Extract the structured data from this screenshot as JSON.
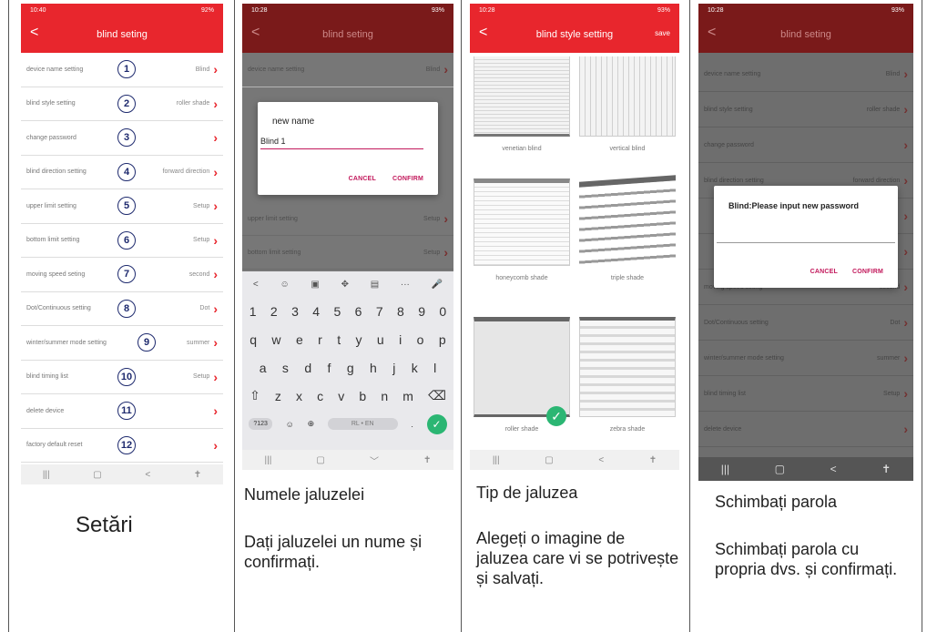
{
  "status": {
    "left": "10:40",
    "right": "92%",
    "left2": "10:28",
    "right2": "93%"
  },
  "screen1": {
    "title": "blind seting",
    "back": "<",
    "rows": [
      {
        "num": "1",
        "label": "device name setting",
        "value": "Blind"
      },
      {
        "num": "2",
        "label": "blind style setting",
        "value": "roller shade"
      },
      {
        "num": "3",
        "label": "change password",
        "value": ""
      },
      {
        "num": "4",
        "label": "blind direction setting",
        "value": "forward direction"
      },
      {
        "num": "5",
        "label": "upper limit setting",
        "value": "Setup"
      },
      {
        "num": "6",
        "label": "bottom limit setting",
        "value": "Setup"
      },
      {
        "num": "7",
        "label": "moving speed seting",
        "value": "second"
      },
      {
        "num": "8",
        "label": "Dot/Continuous setting",
        "value": "Dot"
      },
      {
        "num": "9",
        "label": "winter/summer mode setting",
        "value": "summer"
      },
      {
        "num": "10",
        "label": "blind timing list",
        "value": "Setup"
      },
      {
        "num": "11",
        "label": "delete device",
        "value": ""
      },
      {
        "num": "12",
        "label": "factory default reset",
        "value": ""
      }
    ],
    "nav": [
      "|||",
      "▢",
      "<",
      "✝"
    ]
  },
  "screen2": {
    "title": "blind seting",
    "bg_rows": [
      {
        "label": "device name setting",
        "value": "Blind"
      },
      {
        "label": "upper limit setting",
        "value": "Setup"
      },
      {
        "label": "bottom limit setting",
        "value": "Setup"
      }
    ],
    "dialog": {
      "title": "new name",
      "value": "Blind 1",
      "cancel": "CANCEL",
      "confirm": "CONFIRM"
    },
    "keyboard": {
      "tools": [
        "<",
        "☺",
        "▣",
        "✥",
        "▤",
        "···",
        "🎤"
      ],
      "row1": [
        "1",
        "2",
        "3",
        "4",
        "5",
        "6",
        "7",
        "8",
        "9",
        "0"
      ],
      "row2": [
        "q",
        "w",
        "e",
        "r",
        "t",
        "y",
        "u",
        "i",
        "o",
        "p"
      ],
      "row3": [
        "a",
        "s",
        "d",
        "f",
        "g",
        "h",
        "j",
        "k",
        "l"
      ],
      "row4": [
        "⇧",
        "z",
        "x",
        "c",
        "v",
        "b",
        "n",
        "m",
        "⌫"
      ],
      "row5": [
        "?123",
        "☺",
        "⊕",
        "RL • EN",
        ".",
        "✓"
      ]
    },
    "nav": [
      "|||",
      "▢",
      "﹀",
      "✝"
    ]
  },
  "screen3": {
    "title": "blind style setting",
    "save": "save",
    "blinds": [
      {
        "label": "venetian blind"
      },
      {
        "label": "vertical blind"
      },
      {
        "label": "honeycomb shade"
      },
      {
        "label": "triple shade"
      },
      {
        "label": "roller shade"
      },
      {
        "label": "zebra shade"
      }
    ],
    "nav": [
      "|||",
      "▢",
      "<",
      "✝"
    ]
  },
  "screen4": {
    "title": "blind seting",
    "bg_rows": [
      {
        "label": "device name setting",
        "value": "Blind"
      },
      {
        "label": "blind style setting",
        "value": "roller shade"
      },
      {
        "label": "change password",
        "value": ""
      },
      {
        "label": "blind direction setting",
        "value": "forward direction"
      },
      {
        "label": "",
        "value": ""
      },
      {
        "label": "",
        "value": ""
      },
      {
        "label": "moving speed seting",
        "value": "second"
      },
      {
        "label": "Dot/Continuous setting",
        "value": "Dot"
      },
      {
        "label": "winter/summer mode setting",
        "value": "summer"
      },
      {
        "label": "blind timing list",
        "value": "Setup"
      },
      {
        "label": "delete device",
        "value": ""
      }
    ],
    "dialog": {
      "title": "Blind:Please input new password",
      "cancel": "CANCEL",
      "confirm": "CONFIRM"
    },
    "nav": [
      "|||",
      "▢",
      "<",
      "✝"
    ]
  },
  "captions": {
    "c1": "Setări",
    "c2a": "Numele jaluzelei",
    "c2b": "Dați jaluzelei un nume și confirmați.",
    "c3a": "Tip de jaluzea",
    "c3b": "Alegeți o imagine de jaluzea care vi se potrivește și salvați.",
    "c4a": "Schimbați parola",
    "c4b": "Schimbați parola cu propria dvs. și confirmați."
  },
  "colors": {
    "accent": "#e8262d",
    "dialog_button": "#c2185b",
    "check": "#2bb673",
    "badge": "#1e2a6e"
  }
}
